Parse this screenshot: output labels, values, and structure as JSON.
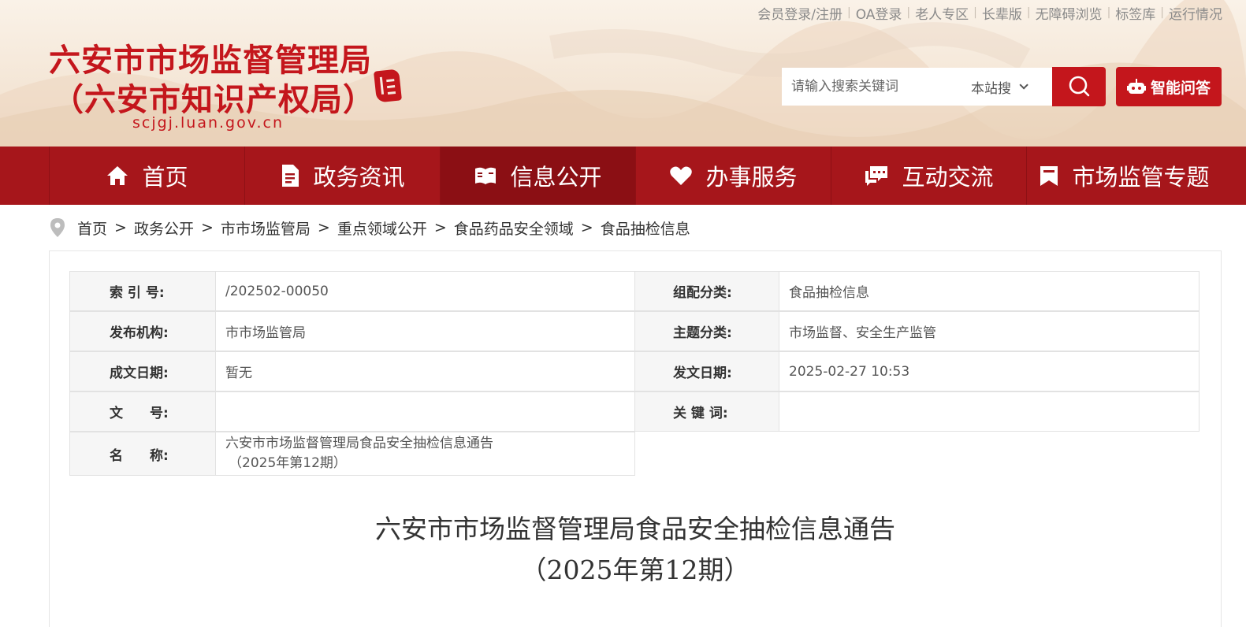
{
  "top_links": [
    "会员登录/注册",
    "OA登录",
    "老人专区",
    "长辈版",
    "无障碍浏览",
    "标签库",
    "运行情况"
  ],
  "logo": {
    "line1": "六安市市场监督管理局",
    "line2": "（六安市知识产权局）",
    "domain": "scjgj.luan.gov.cn"
  },
  "search": {
    "placeholder": "请输入搜索关键词",
    "scope": "本站搜",
    "ai_label": "智能问答"
  },
  "nav": [
    {
      "label": "首页",
      "icon": "home-icon"
    },
    {
      "label": "政务资讯",
      "icon": "document-icon"
    },
    {
      "label": "信息公开",
      "icon": "open-book-icon",
      "active": true
    },
    {
      "label": "办事服务",
      "icon": "heart-icon"
    },
    {
      "label": "互动交流",
      "icon": "chat-icon"
    },
    {
      "label": "市场监管专题",
      "icon": "bookmark-icon"
    }
  ],
  "breadcrumb": [
    "首页",
    "政务公开",
    "市市场监管局",
    "重点领域公开",
    "食品药品安全领域",
    "食品抽检信息"
  ],
  "meta": {
    "index_label": "索 引 号:",
    "index_value": "/202502-00050",
    "category_label": "组配分类:",
    "category_value": "食品抽检信息",
    "publisher_label": "发布机构:",
    "publisher_value": "市市场监管局",
    "topic_label": "主题分类:",
    "topic_value": "市场监督、安全生产监管",
    "created_label": "成文日期:",
    "created_value": "暂无",
    "issued_label": "发文日期:",
    "issued_value": "2025-02-27 10:53",
    "docno_label": "文　　号:",
    "docno_value": "",
    "keywords_label": "关 键 词:",
    "keywords_value": "",
    "name_label": "名　　称:",
    "name_value_line1": "六安市市场监督管理局食品安全抽检信息通告",
    "name_value_line2": "（2025年第12期）"
  },
  "doc_title": {
    "line1": "六安市市场监督管理局食品安全抽检信息通告",
    "line2": "（2025年第12期）"
  },
  "colors": {
    "brand_red": "#c4161c",
    "nav_red": "#a6161b",
    "nav_active": "#8b0f14"
  }
}
